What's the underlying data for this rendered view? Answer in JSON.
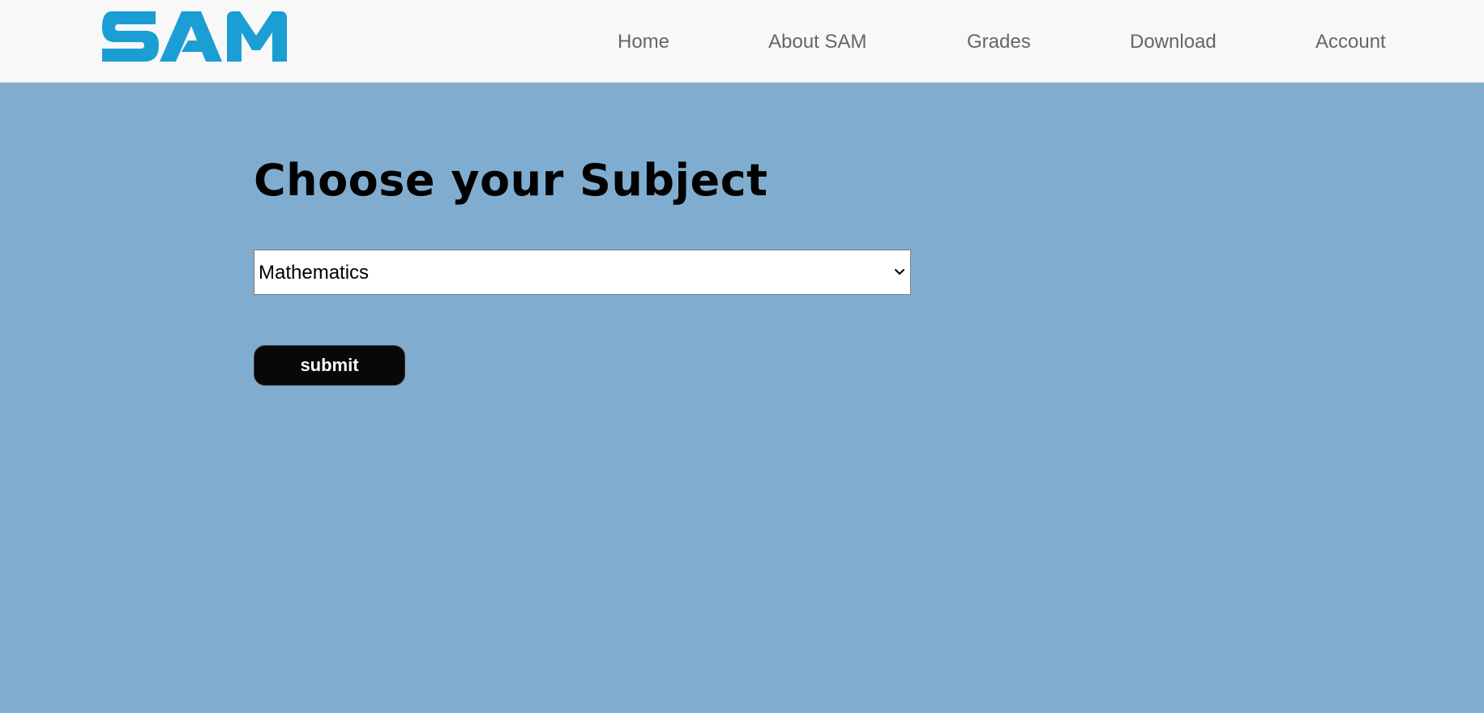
{
  "brand": {
    "logo_text": "SAM",
    "logo_color": "#1a9ed4"
  },
  "nav": {
    "items": [
      {
        "label": "Home"
      },
      {
        "label": "About SAM"
      },
      {
        "label": "Grades"
      },
      {
        "label": "Download"
      },
      {
        "label": "Account"
      }
    ]
  },
  "main": {
    "title": "Choose your Subject",
    "subject_select": {
      "selected": "Mathematics",
      "icon": "chevron-down-icon"
    },
    "submit_label": "submit"
  },
  "colors": {
    "background": "#80adcf",
    "header": "#f8f8f8",
    "nav_text": "#666666",
    "button": "#080808"
  }
}
